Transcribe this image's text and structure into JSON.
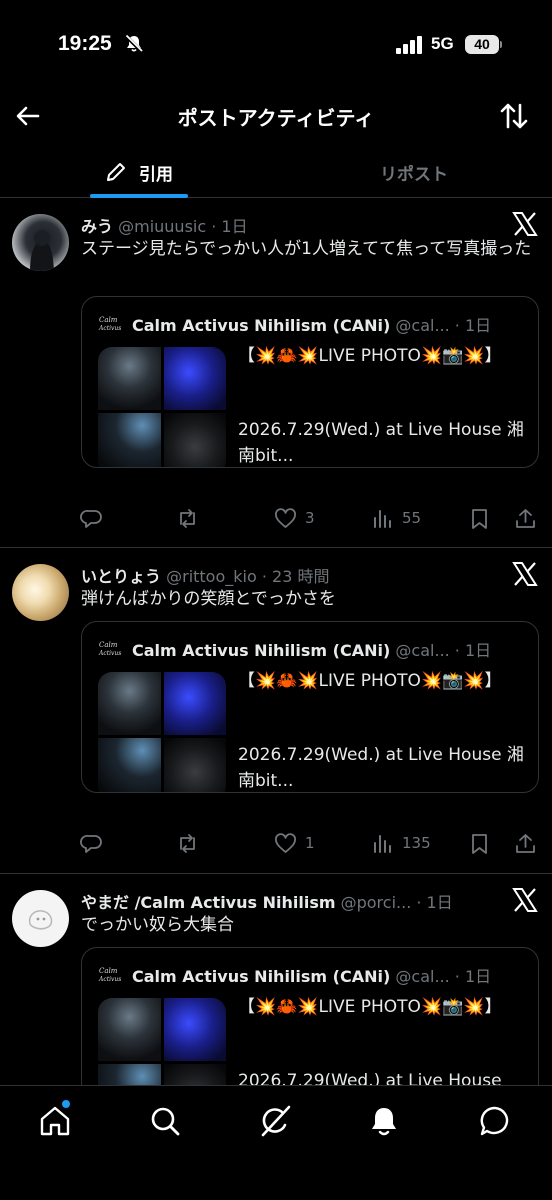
{
  "status_bar": {
    "time": "19:25",
    "network": "5G",
    "battery": "40"
  },
  "header": {
    "title": "ポストアクティビティ"
  },
  "tabs": [
    {
      "label": "引用",
      "selected": true
    },
    {
      "label": "リポスト",
      "selected": false
    }
  ],
  "accent_color": "#1d9bf0",
  "posts": [
    {
      "display_name": "みう",
      "handle": "@miuuusic",
      "time": "· 1日",
      "text": "ステージ見たらでっかい人が1人増えてて焦って写真撮った",
      "quote": {
        "name": "Calm Activus Nihilism (CANi)",
        "handle": "@cal...",
        "time": "· 1日",
        "title": "【💥🦀💥LIVE PHOTO💥📸💥】",
        "body": "2026.7.29(Wed.) at Live House 湘南bit..."
      },
      "actions": {
        "reply": "",
        "repost": "",
        "likes": "3",
        "views": "55"
      }
    },
    {
      "display_name": "いとりょう",
      "handle": "@rittoo_kio",
      "time": "· 23 時間",
      "text": "弾けんばかりの笑顔とでっかさを",
      "quote": {
        "name": "Calm Activus Nihilism (CANi)",
        "handle": "@cal...",
        "time": "· 1日",
        "title": "【💥🦀💥LIVE PHOTO💥📸💥】",
        "body": "2026.7.29(Wed.) at Live House 湘南bit..."
      },
      "actions": {
        "reply": "",
        "repost": "",
        "likes": "1",
        "views": "135"
      }
    },
    {
      "display_name": "やまだ /Calm Activus Nihilism",
      "handle": "@porci...",
      "time": "· 1日",
      "text": "でっかい奴ら大集合",
      "quote": {
        "name": "Calm Activus Nihilism (CANi)",
        "handle": "@cal...",
        "time": "· 1日",
        "title": "【💥🦀💥LIVE PHOTO💥📸💥】",
        "body": "2026.7.29(Wed.) at Live House"
      }
    }
  ]
}
